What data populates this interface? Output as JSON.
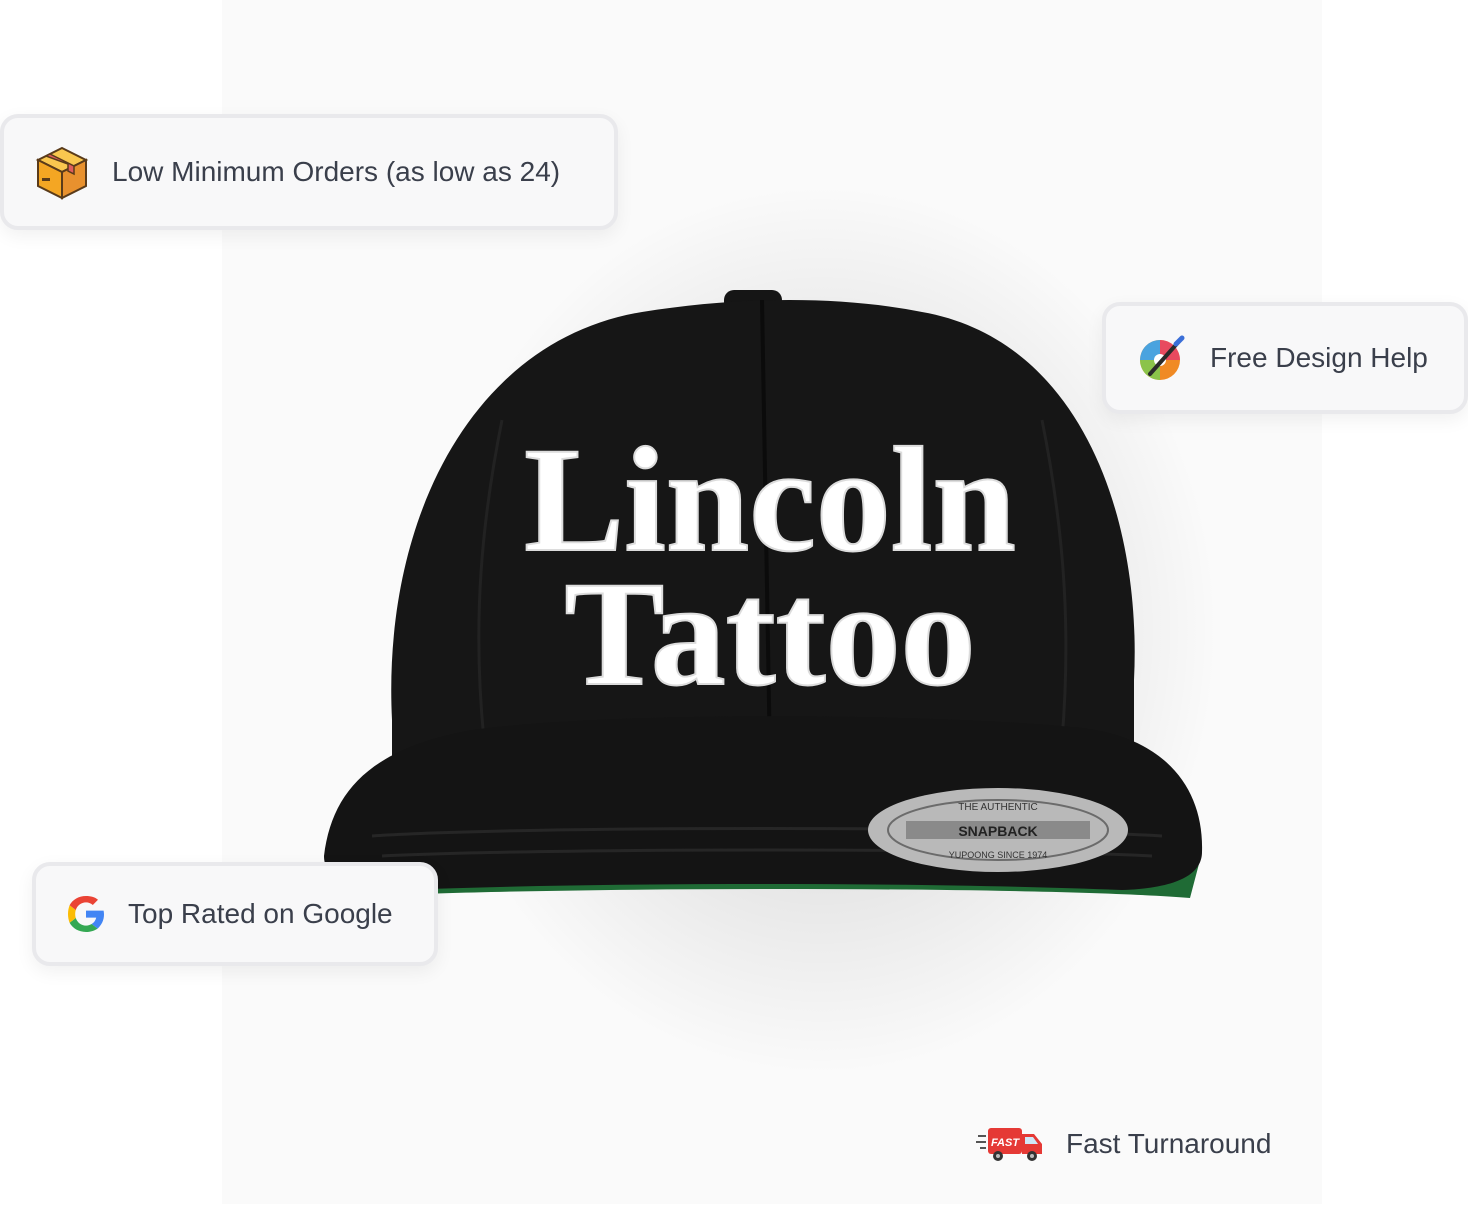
{
  "photo": {
    "alt_subject": "black snapback cap with white embroidered lettering",
    "cap_text_line1": "Lincoln",
    "cap_text_line2": "Tattoo",
    "label_top": "THE AUTHENTIC",
    "label_brand": "YUPOONG",
    "label_main": "SNAPBACK",
    "label_bottom": "YUPOONG SINCE 1974",
    "colors": {
      "cap": "#141414",
      "embroidery": "#ffffff",
      "undervisor": "#1f6b35",
      "label": "#b9b9b9"
    }
  },
  "badges": {
    "orders": {
      "icon": "package-box-icon",
      "label": "Low Minimum Orders (as low as 24)"
    },
    "design": {
      "icon": "paint-palette-icon",
      "label": "Free Design Help"
    },
    "google": {
      "icon": "google-g-icon",
      "label": "Top Rated on Google"
    },
    "fast": {
      "icon": "fast-delivery-truck-icon",
      "label": "Fast Turnaround",
      "truck_text": "FAST"
    }
  },
  "colors": {
    "text": "#3a3f4b",
    "badge_bg": "#f8f8f9",
    "badge_border": "#e9e9ec",
    "panel": "#fafafa"
  }
}
